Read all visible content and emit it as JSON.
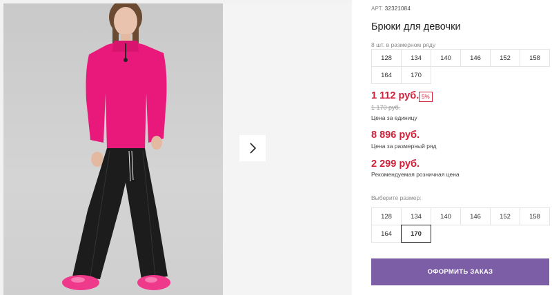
{
  "product": {
    "article_label": "АРТ.",
    "article_number": "32321084",
    "title": "Брюки для девочки",
    "row_note": "8 шт. в размерном ряду"
  },
  "size_row": [
    "128",
    "134",
    "140",
    "146",
    "152",
    "158",
    "164",
    "170"
  ],
  "prices": {
    "unit_price": "1 112 руб.",
    "discount_badge": "5%",
    "old_price": "1 170 руб.",
    "unit_caption": "Цена за единицу",
    "row_price": "8 896 руб.",
    "row_caption": "Цена за размерный ряд",
    "retail_price": "2 299 руб.",
    "retail_caption": "Рекомендуемая розничная цена"
  },
  "size_select": {
    "label": "Выберите размер:",
    "options": [
      "128",
      "134",
      "140",
      "146",
      "152",
      "158",
      "164",
      "170"
    ],
    "selected": "170"
  },
  "order_button": "ОФОРМИТЬ ЗАКАЗ",
  "colors": {
    "accent_red": "#d0203a",
    "order_button": "#7c5ea7",
    "sweater": "#e8197a",
    "pants": "#1c1c1c"
  },
  "icons": {
    "next": "chevron-right-icon"
  }
}
